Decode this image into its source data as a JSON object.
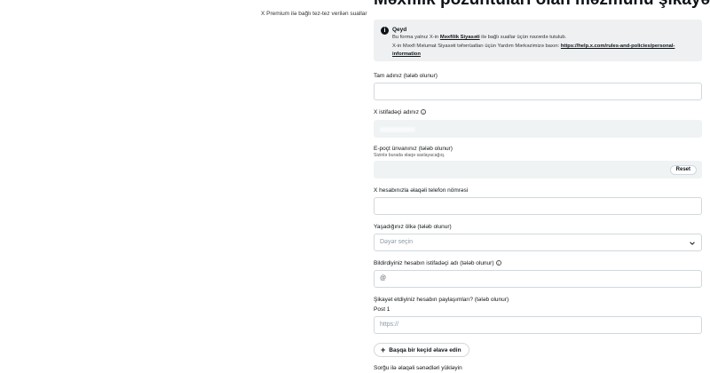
{
  "sidebar": {
    "link": "X Premium ilə bağlı tez-tez verilən suallar"
  },
  "page": {
    "title": "Məxfilik pozuntuları olan məzmunu şikayət edin"
  },
  "notice": {
    "title": "Qeyd",
    "line1_before": "Bu forma yalnız X-in ",
    "line1_link": "Məxfilik Siyasəti",
    "line1_after": " ilə bağlı suallar üçün nəzərdə tutulub.",
    "line2_before": "X-in Məxfi Məlumat Siyasəti təfərrüatları üçün Yardım Mərkəzimizə baxın: ",
    "line2_link": "https://help.x.com/rules-and-policies/personal-information"
  },
  "form": {
    "full_name": {
      "label": "Tam adınız (tələb olunur)",
      "value": ""
    },
    "username": {
      "label": "X istifadəçi adınız"
    },
    "email": {
      "label": "E-poçt ünvanınız (tələb olunur)",
      "hint": "Sizinlə burada əlaqə saxlayacağıq.",
      "reset_label": "Reset"
    },
    "phone": {
      "label": "X hesabınızla əlaqəli telefon nömrəsi",
      "value": ""
    },
    "country": {
      "label": "Yaşadığınız ölkə (tələb olunur)",
      "placeholder": "Dəyər seçin"
    },
    "reported_username": {
      "label": "Bildirdiyiniz hesabın istifadəçi adı (tələb olunur)",
      "prefix": "@"
    },
    "posts": {
      "label": "Şikayət etdiyiniz hesabın paylaşımları? (tələb olunur)",
      "post_label": "Post 1",
      "placeholder": "https://"
    },
    "add_link_label": "Başqa bir keçid əlavə edin",
    "upload_label": "Sorğu ilə əlaqəli sənədləri yükləyin"
  },
  "icons": {
    "notice": "info-circle-icon",
    "username_info": "info-icon",
    "reported_info": "info-icon",
    "select": "chevron-down-icon",
    "add": "plus-icon"
  }
}
